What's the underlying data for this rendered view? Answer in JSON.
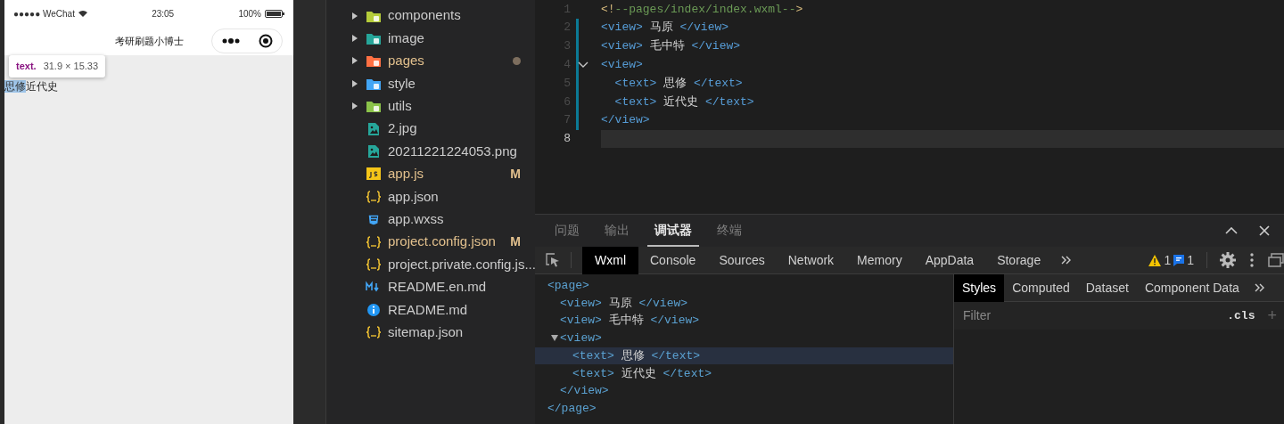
{
  "simulator": {
    "status_bar": {
      "carrier": "●●●●● WeChat",
      "time": "23:05",
      "battery": "100%"
    },
    "nav_bar": {
      "title": "考研刷题小博士"
    },
    "inspect_tooltip": {
      "tag": "text.",
      "size": "31.9 × 15.33"
    },
    "content": [
      {
        "text": "思修",
        "selected": true
      },
      {
        "text": "近代史",
        "selected": false
      }
    ]
  },
  "explorer": {
    "items": [
      {
        "label": "components",
        "kind": "folder",
        "color": "#b5cc3a",
        "modified": false,
        "changed_dot": false
      },
      {
        "label": "image",
        "kind": "folder",
        "color": "#26a69a",
        "modified": false,
        "changed_dot": false
      },
      {
        "label": "pages",
        "kind": "folder",
        "color": "#ff7043",
        "modified": true,
        "changed_dot": true
      },
      {
        "label": "style",
        "kind": "folder",
        "color": "#42a5f5",
        "modified": false,
        "changed_dot": false
      },
      {
        "label": "utils",
        "kind": "folder",
        "color": "#8bc34a",
        "modified": false,
        "changed_dot": false
      },
      {
        "label": "2.jpg",
        "kind": "image",
        "modified": false,
        "changed_dot": false
      },
      {
        "label": "20211221224053.png",
        "kind": "image",
        "modified": false,
        "changed_dot": false
      },
      {
        "label": "app.js",
        "kind": "js",
        "modified": true,
        "changed_dot": false,
        "status": "M"
      },
      {
        "label": "app.json",
        "kind": "json",
        "modified": false,
        "changed_dot": false
      },
      {
        "label": "app.wxss",
        "kind": "css",
        "modified": false,
        "changed_dot": false
      },
      {
        "label": "project.config.json",
        "kind": "json",
        "modified": true,
        "changed_dot": false,
        "status": "M"
      },
      {
        "label": "project.private.config.js...",
        "kind": "json",
        "modified": false,
        "changed_dot": false
      },
      {
        "label": "README.en.md",
        "kind": "markdown",
        "modified": false,
        "changed_dot": false
      },
      {
        "label": "README.md",
        "kind": "info",
        "modified": false,
        "changed_dot": false
      },
      {
        "label": "sitemap.json",
        "kind": "json",
        "modified": false,
        "changed_dot": false
      }
    ]
  },
  "editor": {
    "lines": [
      {
        "number": "1",
        "current": false,
        "fold": false,
        "tokens": [
          {
            "kind": "punct",
            "text": "<!"
          },
          {
            "kind": "comment",
            "text": "--pages/index/index.wxml--"
          },
          {
            "kind": "punct",
            "text": ">"
          }
        ]
      },
      {
        "number": "2",
        "current": false,
        "fold": false,
        "tokens": [
          {
            "kind": "tag",
            "text": "<view>"
          },
          {
            "kind": "plain",
            "text": " 马原 "
          },
          {
            "kind": "tag",
            "text": "</view>"
          }
        ]
      },
      {
        "number": "3",
        "current": false,
        "fold": false,
        "tokens": [
          {
            "kind": "tag",
            "text": "<view>"
          },
          {
            "kind": "plain",
            "text": " 毛中特 "
          },
          {
            "kind": "tag",
            "text": "</view>"
          }
        ]
      },
      {
        "number": "4",
        "current": false,
        "fold": true,
        "tokens": [
          {
            "kind": "tag",
            "text": "<view>"
          }
        ]
      },
      {
        "number": "5",
        "current": false,
        "fold": false,
        "indented": true,
        "tokens": [
          {
            "kind": "tag",
            "text": "<text>"
          },
          {
            "kind": "plain",
            "text": " 思修 "
          },
          {
            "kind": "tag",
            "text": "</text>"
          }
        ]
      },
      {
        "number": "6",
        "current": false,
        "fold": false,
        "indented": true,
        "tokens": [
          {
            "kind": "tag",
            "text": "<text>"
          },
          {
            "kind": "plain",
            "text": " 近代史 "
          },
          {
            "kind": "tag",
            "text": "</text>"
          }
        ]
      },
      {
        "number": "7",
        "current": false,
        "fold": false,
        "tokens": [
          {
            "kind": "tag",
            "text": "</view>"
          }
        ]
      },
      {
        "number": "8",
        "current": true,
        "fold": false
      }
    ]
  },
  "devtools": {
    "panel_tabs": [
      {
        "label": "问题",
        "selected": false
      },
      {
        "label": "输出",
        "selected": false
      },
      {
        "label": "调试器",
        "selected": true
      },
      {
        "label": "终端",
        "selected": false
      }
    ],
    "tool_tabs": [
      {
        "label": "Wxml",
        "selected": true
      },
      {
        "label": "Console",
        "selected": false
      },
      {
        "label": "Sources",
        "selected": false
      },
      {
        "label": "Network",
        "selected": false
      },
      {
        "label": "Memory",
        "selected": false
      },
      {
        "label": "AppData",
        "selected": false
      },
      {
        "label": "Storage",
        "selected": false
      }
    ],
    "warnings": "1",
    "messages": "1",
    "wxml_tree": [
      {
        "open": "<page>",
        "close": "</page>",
        "selected": false,
        "children": [
          {
            "open": "<view>",
            "text": " 马原 ",
            "close": "</view>",
            "selected": false
          },
          {
            "open": "<view>",
            "text": " 毛中特 ",
            "close": "</view>",
            "selected": false
          },
          {
            "open": "<view>",
            "close": "</view>",
            "expanded": true,
            "selected": false,
            "children": [
              {
                "open": "<text>",
                "text": " 思修 ",
                "close": "</text>",
                "selected": true
              },
              {
                "open": "<text>",
                "text": " 近代史 ",
                "close": "</text>",
                "selected": false
              }
            ]
          }
        ]
      }
    ],
    "style_tabs": [
      {
        "label": "Styles",
        "selected": true
      },
      {
        "label": "Computed",
        "selected": false
      },
      {
        "label": "Dataset",
        "selected": false
      },
      {
        "label": "Component Data",
        "selected": false
      }
    ],
    "filter": {
      "placeholder": "Filter"
    },
    "cls_button": ".cls",
    "add_button": "+"
  }
}
